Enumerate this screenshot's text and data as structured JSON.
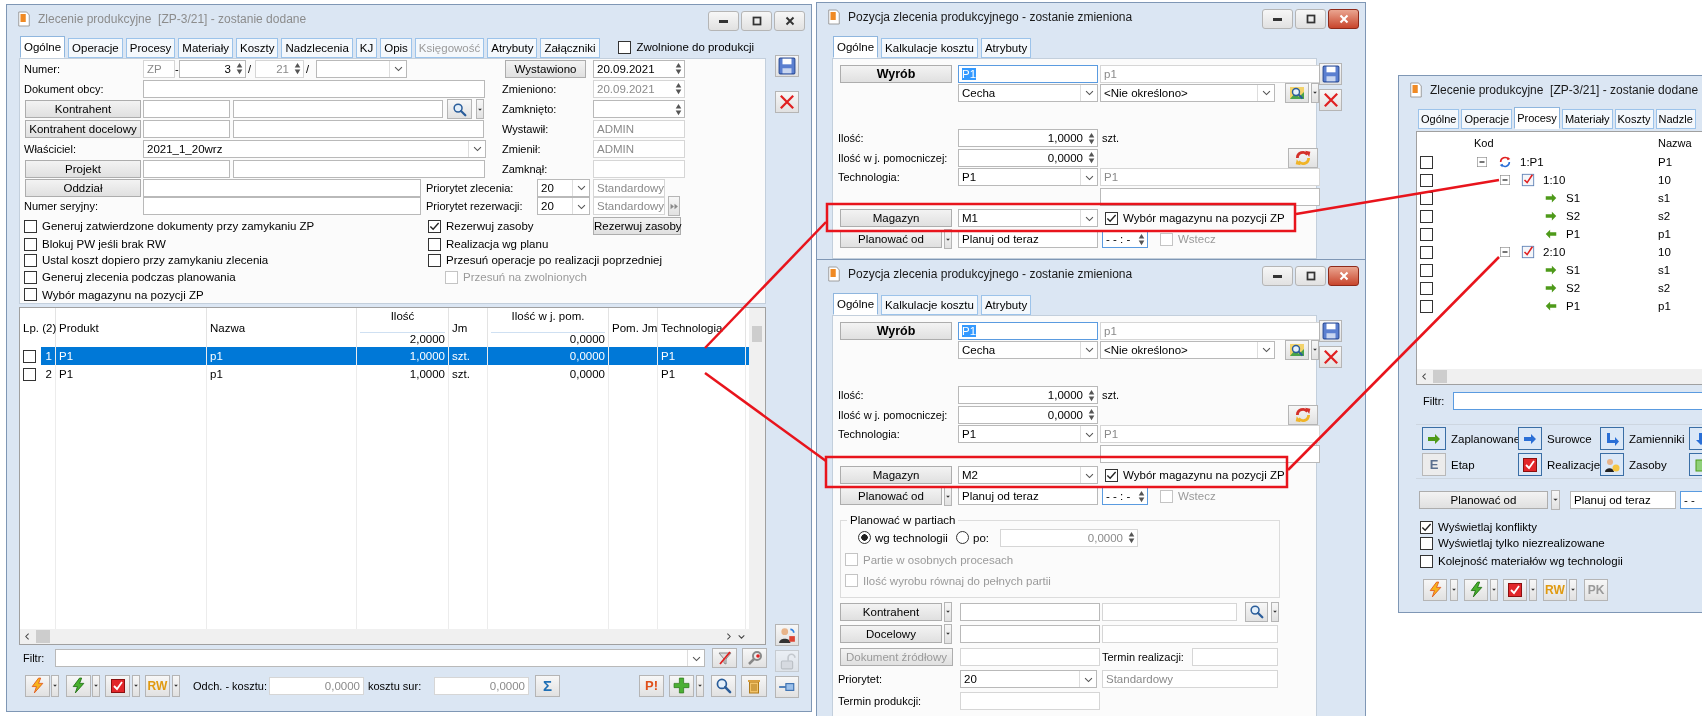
{
  "main_window": {
    "title": "Zlecenie produkcyjne  [ZP-3/21] - zostanie dodane",
    "active": false,
    "tabs": [
      {
        "label": "Ogólne",
        "selected": true,
        "disabled": false
      },
      {
        "label": "Operacje",
        "selected": false,
        "disabled": false
      },
      {
        "label": "Procesy",
        "selected": false,
        "disabled": false
      },
      {
        "label": "Materiały",
        "selected": false,
        "disabled": false
      },
      {
        "label": "Koszty",
        "selected": false,
        "disabled": false
      },
      {
        "label": "Nadzlecenia",
        "selected": false,
        "disabled": false
      },
      {
        "label": "KJ",
        "selected": false,
        "disabled": false
      },
      {
        "label": "Opis",
        "selected": false,
        "disabled": false
      },
      {
        "label": "Księgowość",
        "selected": false,
        "disabled": true
      },
      {
        "label": "Atrybuty",
        "selected": false,
        "disabled": false
      },
      {
        "label": "Załączniki",
        "selected": false,
        "disabled": false
      }
    ],
    "release": {
      "kind": "checkbox",
      "text": "Zwolnione do produkcji",
      "checked": false
    },
    "form": [
      [
        {
          "kind": "label",
          "text": "Numer:"
        },
        {
          "kind": "field",
          "value": "ZP",
          "disabled": true
        },
        {
          "kind": "label",
          "text": "-"
        },
        {
          "kind": "spin",
          "value": "3"
        },
        {
          "kind": "label",
          "text": "/"
        },
        {
          "kind": "spin",
          "value": "21",
          "disabled": true
        },
        {
          "kind": "label",
          "text": "/"
        },
        {
          "kind": "dropdown"
        },
        {
          "kind": "button",
          "text": "Wystawiono"
        },
        {
          "kind": "spin",
          "value": "20.09.2021"
        }
      ],
      [
        {
          "kind": "label",
          "text": "Dokument obcy:"
        },
        {
          "kind": "field"
        },
        {
          "kind": "label",
          "text": "Zmieniono:"
        },
        {
          "kind": "spin",
          "value": "20.09.2021",
          "disabled": true
        }
      ],
      [
        {
          "kind": "button",
          "text": "Kontrahent"
        },
        {
          "kind": "field"
        },
        {
          "kind": "field"
        },
        {
          "kind": "label",
          "text": "Zamknięto:"
        },
        {
          "kind": "spin"
        }
      ],
      [
        {
          "kind": "button",
          "text": "Kontrahent docelowy"
        },
        {
          "kind": "field"
        },
        {
          "kind": "field"
        },
        {
          "kind": "label",
          "text": "Wystawił:"
        },
        {
          "kind": "field",
          "value": "ADMIN",
          "disabled": true
        }
      ],
      [
        {
          "kind": "label",
          "text": "Właściciel:"
        },
        {
          "kind": "dropdown",
          "value": "2021_1_20wrz"
        },
        {
          "kind": "label",
          "text": "Zmienił:"
        },
        {
          "kind": "field",
          "value": "ADMIN",
          "disabled": true
        }
      ],
      [
        {
          "kind": "button",
          "text": "Projekt"
        },
        {
          "kind": "field"
        },
        {
          "kind": "field"
        },
        {
          "kind": "label",
          "text": "Zamknął:"
        },
        {
          "kind": "field",
          "disabled": true
        }
      ],
      [
        {
          "kind": "button",
          "text": "Oddział"
        },
        {
          "kind": "field"
        },
        {
          "kind": "label",
          "text": "Priorytet zlecenia:"
        },
        {
          "kind": "dropdown",
          "value": "20"
        },
        {
          "kind": "field",
          "value": "Standardowy",
          "disabled": true
        }
      ],
      [
        {
          "kind": "label",
          "text": "Numer seryjny:"
        },
        {
          "kind": "field"
        },
        {
          "kind": "label",
          "text": "Priorytet rezerwacji:"
        },
        {
          "kind": "dropdown",
          "value": "20"
        },
        {
          "kind": "field",
          "value": "Standardowy",
          "disabled": true
        }
      ],
      [
        {
          "kind": "checkbox",
          "text": "Generuj zatwierdzone dokumenty przy zamykaniu ZP",
          "checked": false,
          "disabled": false
        },
        {
          "kind": "checkbox",
          "text": "Rezerwuj zasoby",
          "checked": true,
          "disabled": false
        },
        {
          "kind": "button",
          "text": "Rezerwuj zasoby"
        }
      ],
      [
        {
          "kind": "checkbox",
          "text": "Blokuj PW jeśli brak RW",
          "checked": false,
          "disabled": false
        },
        {
          "kind": "checkbox",
          "text": "Realizacja wg planu",
          "checked": false,
          "disabled": false
        }
      ],
      [
        {
          "kind": "checkbox",
          "text": "Ustal koszt dopiero przy zamykaniu zlecenia",
          "checked": false,
          "disabled": false
        },
        {
          "kind": "checkbox",
          "text": "Przesuń operacje po realizacji poprzedniej",
          "checked": false,
          "disabled": false
        }
      ],
      [
        {
          "kind": "checkbox",
          "text": "Generuj zlecenia podczas planowania",
          "checked": false,
          "disabled": false
        },
        {
          "kind": "checkbox",
          "text": "Przesuń na zwolnionych",
          "checked": false,
          "disabled": true
        }
      ],
      [
        {
          "kind": "checkbox",
          "text": "Wybór magazynu na pozycji ZP",
          "checked": false,
          "disabled": false
        }
      ]
    ],
    "table": {
      "columns": [
        {
          "label": "Lp. (2)"
        },
        {
          "label": "Produkt"
        },
        {
          "label": "Nazwa"
        },
        {
          "label": "Ilość",
          "total": "2,0000"
        },
        {
          "label": "Jm"
        },
        {
          "label": "Ilość w j. pom.",
          "total": "0,0000"
        },
        {
          "label": "Pom. Jm"
        },
        {
          "label": "Technologia"
        }
      ],
      "rows": [
        {
          "lp": "1",
          "product": "P1",
          "name": "p1",
          "quantity": "1,0000",
          "unit": "szt.",
          "aux_quantity": "0,0000",
          "technology": "P1",
          "selected": true,
          "checked": false
        },
        {
          "lp": "2",
          "product": "P1",
          "name": "p1",
          "quantity": "1,0000",
          "unit": "szt.",
          "aux_quantity": "0,0000",
          "technology": "P1",
          "selected": false,
          "checked": false
        }
      ]
    },
    "filter_label": "Filtr:",
    "footer": {
      "rw": "RW",
      "deviation_label": "Odch. - kosztu:",
      "deviation": "0,0000",
      "raw_cost_label": "kosztu sur:",
      "raw_cost": "0,0000",
      "sum": "Σ",
      "alert": "P!"
    }
  },
  "item_windows": [
    {
      "title": "Pozycja zlecenia produkcyjnego - zostanie zmieniona",
      "active": true,
      "tabs": [
        {
          "label": "Ogólne",
          "selected": true
        },
        {
          "label": "Kalkulacje kosztu",
          "selected": false
        },
        {
          "label": "Atrybuty",
          "selected": false
        }
      ],
      "form": [
        [
          {
            "kind": "primary-button",
            "text": "Wyrób"
          },
          {
            "kind": "field",
            "value": "P1",
            "highlighted": true
          },
          {
            "kind": "field",
            "value": "p1",
            "disabled": true
          }
        ],
        [
          {
            "kind": "dropdown",
            "value": "Cecha"
          },
          {
            "kind": "dropdown",
            "value": "<Nie określono>"
          }
        ],
        [
          {
            "kind": "label",
            "text": "Ilość:"
          },
          {
            "kind": "spin",
            "value": "1,0000"
          },
          {
            "kind": "label",
            "text": "szt."
          }
        ],
        [
          {
            "kind": "label",
            "text": "Ilość w j. pomocniczej:"
          },
          {
            "kind": "spin",
            "value": "0,0000"
          }
        ],
        [
          {
            "kind": "label",
            "text": "Technologia:"
          },
          {
            "kind": "dropdown",
            "value": "P1"
          },
          {
            "kind": "field",
            "value": "P1",
            "disabled": true
          }
        ],
        [
          {
            "kind": "field"
          }
        ],
        [
          {
            "kind": "button",
            "text": "Magazyn"
          },
          {
            "kind": "dropdown",
            "value": "M1"
          },
          {
            "kind": "checkbox",
            "text": "Wybór magazynu na pozycji ZP",
            "checked": true,
            "disabled": false
          }
        ],
        [
          {
            "kind": "button",
            "text": "Planować od"
          },
          {
            "kind": "field",
            "value": "Planuj od teraz"
          },
          {
            "kind": "spin",
            "value": "- - : -"
          },
          {
            "kind": "checkbox",
            "text": "Wstecz",
            "checked": false,
            "disabled": true
          }
        ]
      ]
    },
    {
      "title": "Pozycja zlecenia produkcyjnego - zostanie zmieniona",
      "active": true,
      "tabs": [
        {
          "label": "Ogólne",
          "selected": true
        },
        {
          "label": "Kalkulacje kosztu",
          "selected": false
        },
        {
          "label": "Atrybuty",
          "selected": false
        }
      ],
      "form": [
        [
          {
            "kind": "primary-button",
            "text": "Wyrób"
          },
          {
            "kind": "field",
            "value": "P1",
            "highlighted": true
          },
          {
            "kind": "field",
            "value": "p1",
            "disabled": true
          }
        ],
        [
          {
            "kind": "dropdown",
            "value": "Cecha"
          },
          {
            "kind": "dropdown",
            "value": "<Nie określono>"
          }
        ],
        [
          {
            "kind": "label",
            "text": "Ilość:"
          },
          {
            "kind": "spin",
            "value": "1,0000"
          },
          {
            "kind": "label",
            "text": "szt."
          }
        ],
        [
          {
            "kind": "label",
            "text": "Ilość w j. pomocniczej:"
          },
          {
            "kind": "spin",
            "value": "0,0000"
          }
        ],
        [
          {
            "kind": "label",
            "text": "Technologia:"
          },
          {
            "kind": "dropdown",
            "value": "P1"
          },
          {
            "kind": "field",
            "value": "P1",
            "disabled": true
          }
        ],
        [
          {
            "kind": "field"
          }
        ],
        [
          {
            "kind": "button",
            "text": "Magazyn"
          },
          {
            "kind": "dropdown",
            "value": "M2"
          },
          {
            "kind": "checkbox",
            "text": "Wybór magazynu na pozycji ZP",
            "checked": true,
            "disabled": false
          }
        ],
        [
          {
            "kind": "button",
            "text": "Planować od"
          },
          {
            "kind": "field",
            "value": "Planuj od teraz"
          },
          {
            "kind": "spin",
            "value": "- - : -"
          },
          {
            "kind": "checkbox",
            "text": "Wstecz",
            "checked": false,
            "disabled": true
          }
        ]
      ],
      "batch_planning": {
        "title": "Planować w partiach",
        "modes": [
          {
            "kind": "radio",
            "text": "wg technologii",
            "selected": true
          },
          {
            "kind": "radio",
            "text": "po:",
            "selected": false
          }
        ],
        "batch_size": {
          "kind": "spin",
          "value": "0,0000",
          "disabled": true
        },
        "options": [
          {
            "kind": "checkbox",
            "text": "Partie w osobnych procesach",
            "checked": false,
            "disabled": true
          },
          {
            "kind": "checkbox",
            "text": "Ilość wyrobu równaj do pełnych partii",
            "checked": false,
            "disabled": true
          }
        ]
      },
      "details": [
        [
          {
            "kind": "button",
            "text": "Kontrahent"
          },
          {
            "kind": "field"
          },
          {
            "kind": "field",
            "disabled": true
          }
        ],
        [
          {
            "kind": "button",
            "text": "Docelowy"
          },
          {
            "kind": "field"
          },
          {
            "kind": "field",
            "disabled": true
          }
        ],
        [
          {
            "kind": "button",
            "text": "Dokument źródłowy",
            "disabled": true
          },
          {
            "kind": "field",
            "disabled": true
          },
          {
            "kind": "label",
            "text": "Termin realizacji:"
          },
          {
            "kind": "field",
            "disabled": true
          }
        ],
        [
          {
            "kind": "label",
            "text": "Priorytet:"
          },
          {
            "kind": "dropdown",
            "value": "20"
          },
          {
            "kind": "field",
            "value": "Standardowy",
            "disabled": true
          }
        ],
        [
          {
            "kind": "label",
            "text": "Termin produkcji:"
          },
          {
            "kind": "field",
            "disabled": true
          }
        ]
      ]
    }
  ],
  "process_window": {
    "title": "Zlecenie produkcyjne  [ZP-3/21] - zostanie dodane",
    "active": true,
    "tabs": [
      {
        "label": "Ogólne",
        "selected": false
      },
      {
        "label": "Operacje",
        "selected": false
      },
      {
        "label": "Procesy",
        "selected": true
      },
      {
        "label": "Materiały",
        "selected": false
      },
      {
        "label": "Koszty",
        "selected": false
      },
      {
        "label": "Nadzle",
        "selected": false
      }
    ],
    "tree": {
      "columns": [
        "Kod",
        "Nazwa"
      ],
      "nodes": [
        {
          "code": "1:P1",
          "name": "P1",
          "kind": "process",
          "checked": false,
          "expanded": true,
          "children": [
            {
              "code": "1:10",
              "name": "10",
              "kind": "operation",
              "checked": false,
              "expanded": true,
              "children": [
                {
                  "code": "S1",
                  "name": "s1",
                  "kind": "input",
                  "checked": false
                },
                {
                  "code": "S2",
                  "name": "s2",
                  "kind": "input",
                  "checked": false
                },
                {
                  "code": "P1",
                  "name": "p1",
                  "kind": "output",
                  "checked": false
                }
              ]
            },
            {
              "code": "2:10",
              "name": "10",
              "kind": "operation",
              "checked": false,
              "expanded": true,
              "children": [
                {
                  "code": "S1",
                  "name": "s1",
                  "kind": "input",
                  "checked": false
                },
                {
                  "code": "S2",
                  "name": "s2",
                  "kind": "input",
                  "checked": false
                },
                {
                  "code": "P1",
                  "name": "p1",
                  "kind": "output",
                  "checked": false
                }
              ]
            }
          ]
        }
      ]
    },
    "filter_label": "Filtr:",
    "legend": [
      {
        "kind": "planned",
        "label": "Zaplanowane"
      },
      {
        "kind": "raw",
        "label": "Surowce"
      },
      {
        "kind": "substitute",
        "label": "Zamienniki"
      },
      {
        "kind": "stage",
        "label": "Etap",
        "icon_text": "E"
      },
      {
        "kind": "realization",
        "label": "Realizacje"
      },
      {
        "kind": "resources",
        "label": "Zasoby"
      }
    ],
    "planning": {
      "button": "Planować od",
      "value": "Planuj od teraz",
      "time": "- -"
    },
    "options": [
      {
        "kind": "checkbox",
        "text": "Wyświetlaj konflikty",
        "checked": true
      },
      {
        "kind": "checkbox",
        "text": "Wyświetlaj tylko niezrealizowane",
        "checked": false
      },
      {
        "kind": "checkbox",
        "text": "Kolejność materiałów wg technologii",
        "checked": false
      }
    ],
    "toolbar": {
      "rw": "RW",
      "pk": "PK"
    }
  }
}
